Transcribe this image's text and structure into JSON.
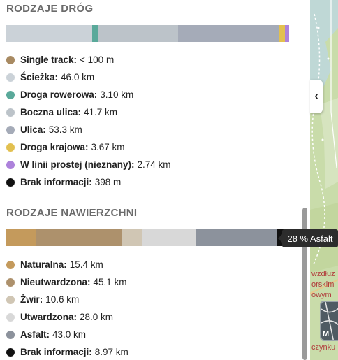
{
  "road_types": {
    "title": "RODZAJE DRÓG",
    "segments": [
      {
        "color": "#cbd2d8",
        "pct": 30.3
      },
      {
        "color": "#5aa99a",
        "pct": 2.0
      },
      {
        "color": "#bcc3c9",
        "pct": 28.4
      },
      {
        "color": "#a5abb8",
        "pct": 35.6
      },
      {
        "color": "#e2c050",
        "pct": 2.2
      },
      {
        "color": "#ad82db",
        "pct": 1.5
      }
    ],
    "items": [
      {
        "name": "Single track:",
        "value": "< 100 m",
        "color": "#a88a62"
      },
      {
        "name": "Ścieżka:",
        "value": "46.0 km",
        "color": "#cbd2d8"
      },
      {
        "name": "Droga rowerowa:",
        "value": "3.10 km",
        "color": "#5aa99a"
      },
      {
        "name": "Boczna ulica:",
        "value": "41.7 km",
        "color": "#bcc3c9"
      },
      {
        "name": "Ulica:",
        "value": "53.3 km",
        "color": "#a5abb8"
      },
      {
        "name": "Droga krajowa:",
        "value": "3.67 km",
        "color": "#e2c050"
      },
      {
        "name": "W linii prostej (nieznany):",
        "value": "2.74 km",
        "color": "#ad82db"
      },
      {
        "name": "Brak informacji:",
        "value": "398 m",
        "color": "#111111"
      }
    ]
  },
  "surface_types": {
    "title": "RODZAJE NAWIERZCHNI",
    "segments": [
      {
        "color": "#c49a5c",
        "pct": 10.3
      },
      {
        "color": "#ad916c",
        "pct": 30.5
      },
      {
        "color": "#d0c6b4",
        "pct": 7.0
      },
      {
        "color": "#d8d8d8",
        "pct": 19.4
      },
      {
        "color": "#8c929c",
        "pct": 28.6
      },
      {
        "color": "#111111",
        "pct": 4.2
      }
    ],
    "items": [
      {
        "name": "Naturalna:",
        "value": "15.4 km",
        "color": "#c49a5c"
      },
      {
        "name": "Nieutwardzona:",
        "value": "45.1 km",
        "color": "#ad916c"
      },
      {
        "name": "Żwir:",
        "value": "10.6 km",
        "color": "#d0c6b4"
      },
      {
        "name": "Utwardzona:",
        "value": "28.0 km",
        "color": "#d8d8d8"
      },
      {
        "name": "Asfalt:",
        "value": "43.0 km",
        "color": "#8c929c"
      },
      {
        "name": "Brak informacji:",
        "value": "8.97 km",
        "color": "#111111"
      }
    ]
  },
  "tooltip": {
    "text": "28 % Asfalt"
  },
  "collapse_button": {
    "icon": "chevron-left-icon",
    "glyph": "‹"
  },
  "map": {
    "labels": [
      "wzdłuż",
      "orskim",
      "owym",
      "czynku"
    ],
    "button_label": "M"
  }
}
